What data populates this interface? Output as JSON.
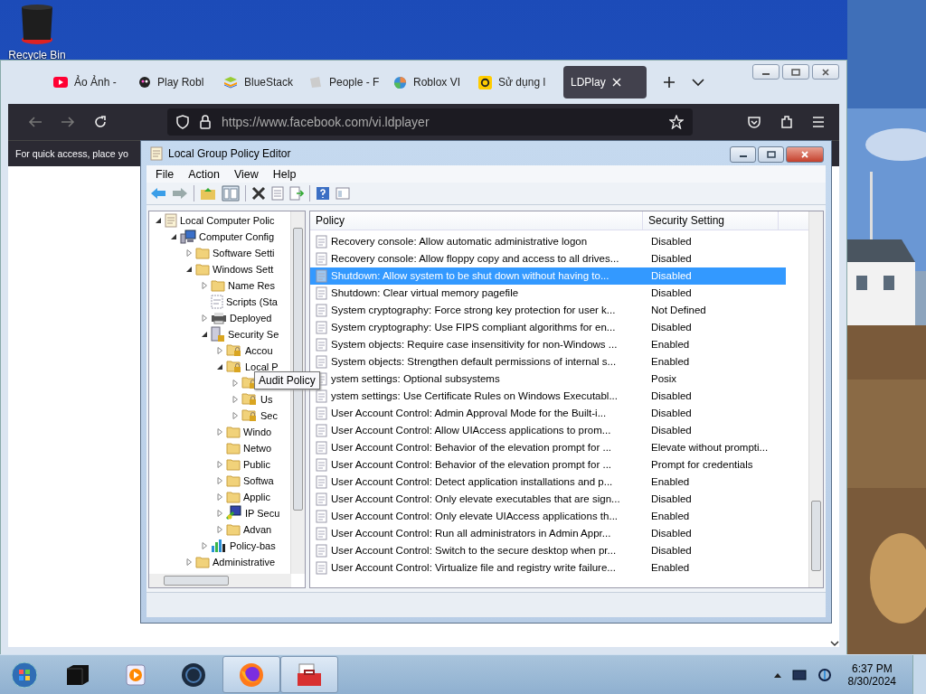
{
  "desktop": {
    "icon_label": "Recycle Bin"
  },
  "browser": {
    "tabs": [
      {
        "label": "Ảo Ảnh -",
        "kind": "video",
        "selected": false
      },
      {
        "label": "Play Robl",
        "kind": "robot",
        "selected": false
      },
      {
        "label": "BlueStack",
        "kind": "stack",
        "selected": false
      },
      {
        "label": "People - F",
        "kind": "page",
        "selected": false
      },
      {
        "label": "Roblox VI",
        "kind": "globe",
        "selected": false
      },
      {
        "label": "Sử dụng l",
        "kind": "coin",
        "selected": false
      },
      {
        "label": "LDPlay",
        "kind": "none",
        "selected": true
      }
    ],
    "url": "https://www.facebook.com/vi.ldplayer",
    "notice": "For quick access, place yo"
  },
  "gpe": {
    "title": "Local Group Policy Editor",
    "menu": [
      "File",
      "Action",
      "View",
      "Help"
    ],
    "tree": [
      {
        "label": "Local Computer Polic",
        "kind": "policy",
        "expanded": true,
        "children": [
          {
            "label": "Computer Config",
            "kind": "computer",
            "expanded": true,
            "children": [
              {
                "label": "Software Setti",
                "kind": "folder",
                "expanded": false
              },
              {
                "label": "Windows Sett",
                "kind": "folder",
                "expanded": true,
                "children": [
                  {
                    "label": "Name Res",
                    "kind": "folder",
                    "expanded": false
                  },
                  {
                    "label": "Scripts (Sta",
                    "kind": "script"
                  },
                  {
                    "label": "Deployed",
                    "kind": "printer",
                    "expanded": false
                  },
                  {
                    "label": "Security Se",
                    "kind": "security",
                    "expanded": true,
                    "children": [
                      {
                        "label": "Accou",
                        "kind": "locked",
                        "expanded": false
                      },
                      {
                        "label": "Local P",
                        "kind": "locked",
                        "expanded": true,
                        "children": [
                          {
                            "kind": "locked",
                            "expanded": false
                          },
                          {
                            "label": "Us",
                            "kind": "locked",
                            "expanded": false
                          },
                          {
                            "label": "Sec",
                            "kind": "locked",
                            "expanded": false
                          }
                        ]
                      },
                      {
                        "label": "Windo",
                        "kind": "folder",
                        "expanded": false
                      },
                      {
                        "label": "Netwo",
                        "kind": "folder"
                      },
                      {
                        "label": "Public",
                        "kind": "folder",
                        "expanded": false
                      },
                      {
                        "label": "Softwa",
                        "kind": "folder",
                        "expanded": false
                      },
                      {
                        "label": "Applic",
                        "kind": "folder",
                        "expanded": false
                      },
                      {
                        "label": "IP Secu",
                        "kind": "network",
                        "expanded": false
                      },
                      {
                        "label": "Advan",
                        "kind": "folder",
                        "expanded": false
                      }
                    ]
                  },
                  {
                    "label": "Policy-bas",
                    "kind": "chart",
                    "expanded": false
                  }
                ]
              },
              {
                "label": "Administrative",
                "kind": "folder",
                "expanded": false
              }
            ]
          }
        ]
      }
    ],
    "tooltip": "Audit Policy",
    "columns": [
      "Policy",
      "Security Setting"
    ],
    "rows": [
      {
        "policy": "Recovery console: Allow automatic administrative logon",
        "setting": "Disabled",
        "selected": false
      },
      {
        "policy": "Recovery console: Allow floppy copy and access to all drives...",
        "setting": "Disabled",
        "selected": false
      },
      {
        "policy": "Shutdown: Allow system to be shut down without having to...",
        "setting": "Disabled",
        "selected": true
      },
      {
        "policy": "Shutdown: Clear virtual memory pagefile",
        "setting": "Disabled",
        "selected": false
      },
      {
        "policy": "System cryptography: Force strong key protection for user k...",
        "setting": "Not Defined",
        "selected": false
      },
      {
        "policy": "System cryptography: Use FIPS compliant algorithms for en...",
        "setting": "Disabled",
        "selected": false
      },
      {
        "policy": "System objects: Require case insensitivity for non-Windows ...",
        "setting": "Enabled",
        "selected": false
      },
      {
        "policy": "System objects: Strengthen default permissions of internal s...",
        "setting": "Enabled",
        "selected": false
      },
      {
        "policy": "ystem settings: Optional subsystems",
        "setting": "Posix",
        "selected": false
      },
      {
        "policy": "ystem settings: Use Certificate Rules on Windows Executabl...",
        "setting": "Disabled",
        "selected": false
      },
      {
        "policy": "User Account Control: Admin Approval Mode for the Built-i...",
        "setting": "Disabled",
        "selected": false
      },
      {
        "policy": "User Account Control: Allow UIAccess applications to prom...",
        "setting": "Disabled",
        "selected": false
      },
      {
        "policy": "User Account Control: Behavior of the elevation prompt for ...",
        "setting": "Elevate without prompti...",
        "selected": false
      },
      {
        "policy": "User Account Control: Behavior of the elevation prompt for ...",
        "setting": "Prompt for credentials",
        "selected": false
      },
      {
        "policy": "User Account Control: Detect application installations and p...",
        "setting": "Enabled",
        "selected": false
      },
      {
        "policy": "User Account Control: Only elevate executables that are sign...",
        "setting": "Disabled",
        "selected": false
      },
      {
        "policy": "User Account Control: Only elevate UIAccess applications th...",
        "setting": "Enabled",
        "selected": false
      },
      {
        "policy": "User Account Control: Run all administrators in Admin Appr...",
        "setting": "Disabled",
        "selected": false
      },
      {
        "policy": "User Account Control: Switch to the secure desktop when pr...",
        "setting": "Disabled",
        "selected": false
      },
      {
        "policy": "User Account Control: Virtualize file and registry write failure...",
        "setting": "Enabled",
        "selected": false
      }
    ]
  },
  "taskbar": {
    "apps": [
      {
        "kind": "box",
        "active": false
      },
      {
        "kind": "media",
        "active": false
      },
      {
        "kind": "globe",
        "active": false
      },
      {
        "kind": "firefox",
        "active": true
      },
      {
        "kind": "toolbox",
        "active": true
      }
    ],
    "time": "6:37 PM",
    "date": "8/30/2024"
  }
}
